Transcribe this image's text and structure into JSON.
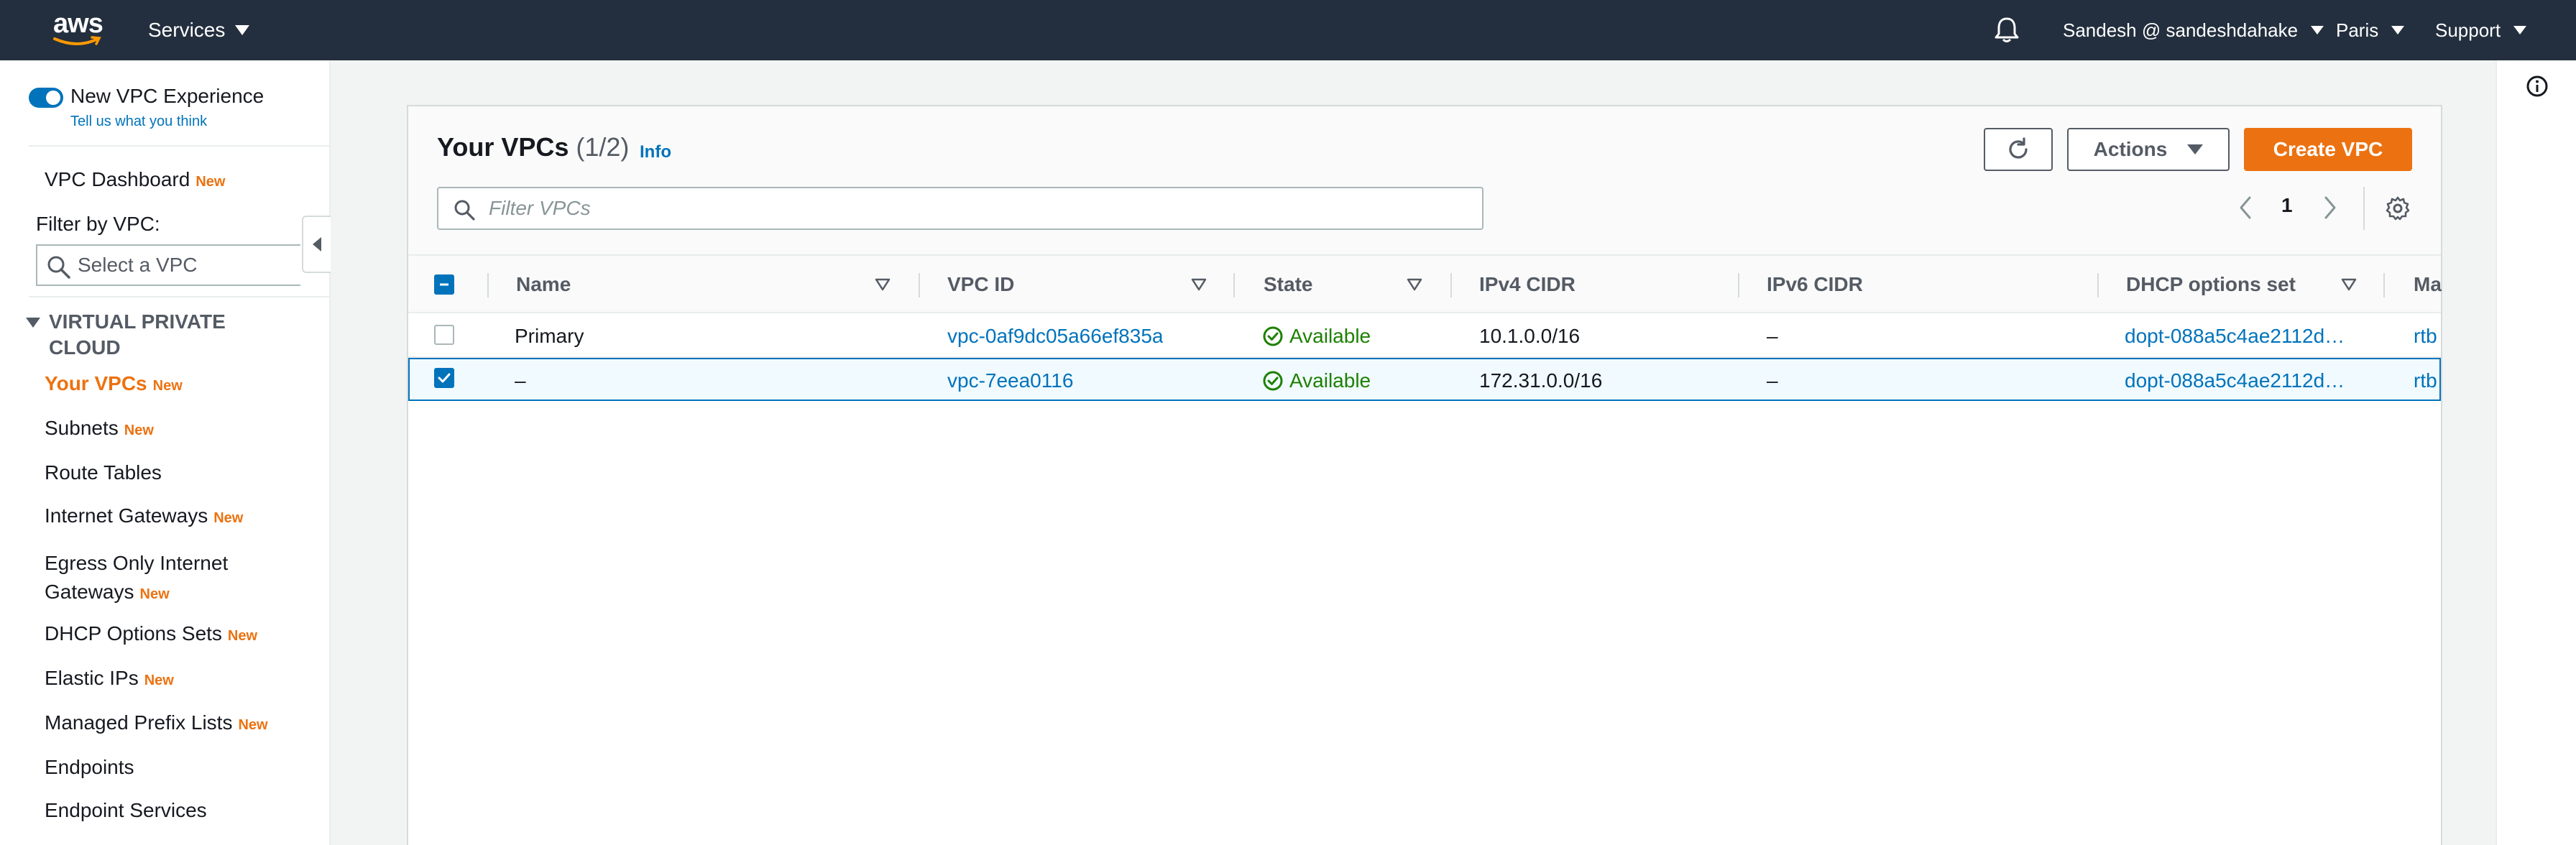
{
  "topnav": {
    "logo_text": "aws",
    "services_label": "Services",
    "user_label": "Sandesh @ sandeshdahake",
    "region_label": "Paris",
    "support_label": "Support"
  },
  "sidebar": {
    "toggle_label": "New VPC Experience",
    "tell_us": "Tell us what you think",
    "dashboard_label": "VPC Dashboard",
    "new_badge": "New",
    "filter_label": "Filter by VPC:",
    "select_placeholder": "Select a VPC",
    "section_title_line1": "VIRTUAL PRIVATE",
    "section_title_line2": "CLOUD",
    "items": [
      {
        "label": "Your VPCs",
        "new": "New"
      },
      {
        "label": "Subnets",
        "new": "New"
      },
      {
        "label": "Route Tables",
        "new": ""
      },
      {
        "label": "Internet Gateways",
        "new": "New"
      },
      {
        "label": "Egress Only Internet",
        "label2": "Gateways",
        "new": "New"
      },
      {
        "label": "DHCP Options Sets",
        "new": "New"
      },
      {
        "label": "Elastic IPs",
        "new": "New"
      },
      {
        "label": "Managed Prefix Lists",
        "new": "New"
      },
      {
        "label": "Endpoints",
        "new": ""
      },
      {
        "label": "Endpoint Services",
        "new": ""
      }
    ]
  },
  "main": {
    "title": "Your VPCs",
    "count": "(1/2)",
    "info": "Info",
    "actions_label": "Actions",
    "create_label": "Create VPC",
    "search_placeholder": "Filter VPCs",
    "page_number": "1",
    "columns": {
      "name": "Name",
      "vpc_id": "VPC ID",
      "state": "State",
      "ipv4": "IPv4 CIDR",
      "ipv6": "IPv6 CIDR",
      "dhcp": "DHCP options set",
      "main_rt": "Ma"
    },
    "rows": [
      {
        "name": "Primary",
        "vpc_id": "vpc-0af9dc05a66ef835a",
        "state": "Available",
        "ipv4": "10.1.0.0/16",
        "ipv6": "–",
        "dhcp": "dopt-088a5c4ae2112d…",
        "main_rt": "rtb"
      },
      {
        "name": "–",
        "vpc_id": "vpc-7eea0116",
        "state": "Available",
        "ipv4": "172.31.0.0/16",
        "ipv6": "–",
        "dhcp": "dopt-088a5c4ae2112d…",
        "main_rt": "rtb"
      }
    ]
  },
  "colors": {
    "nav_bg": "#232f3e",
    "accent_orange": "#ec7211",
    "link_blue": "#0073bb",
    "success_green": "#1d8102"
  }
}
